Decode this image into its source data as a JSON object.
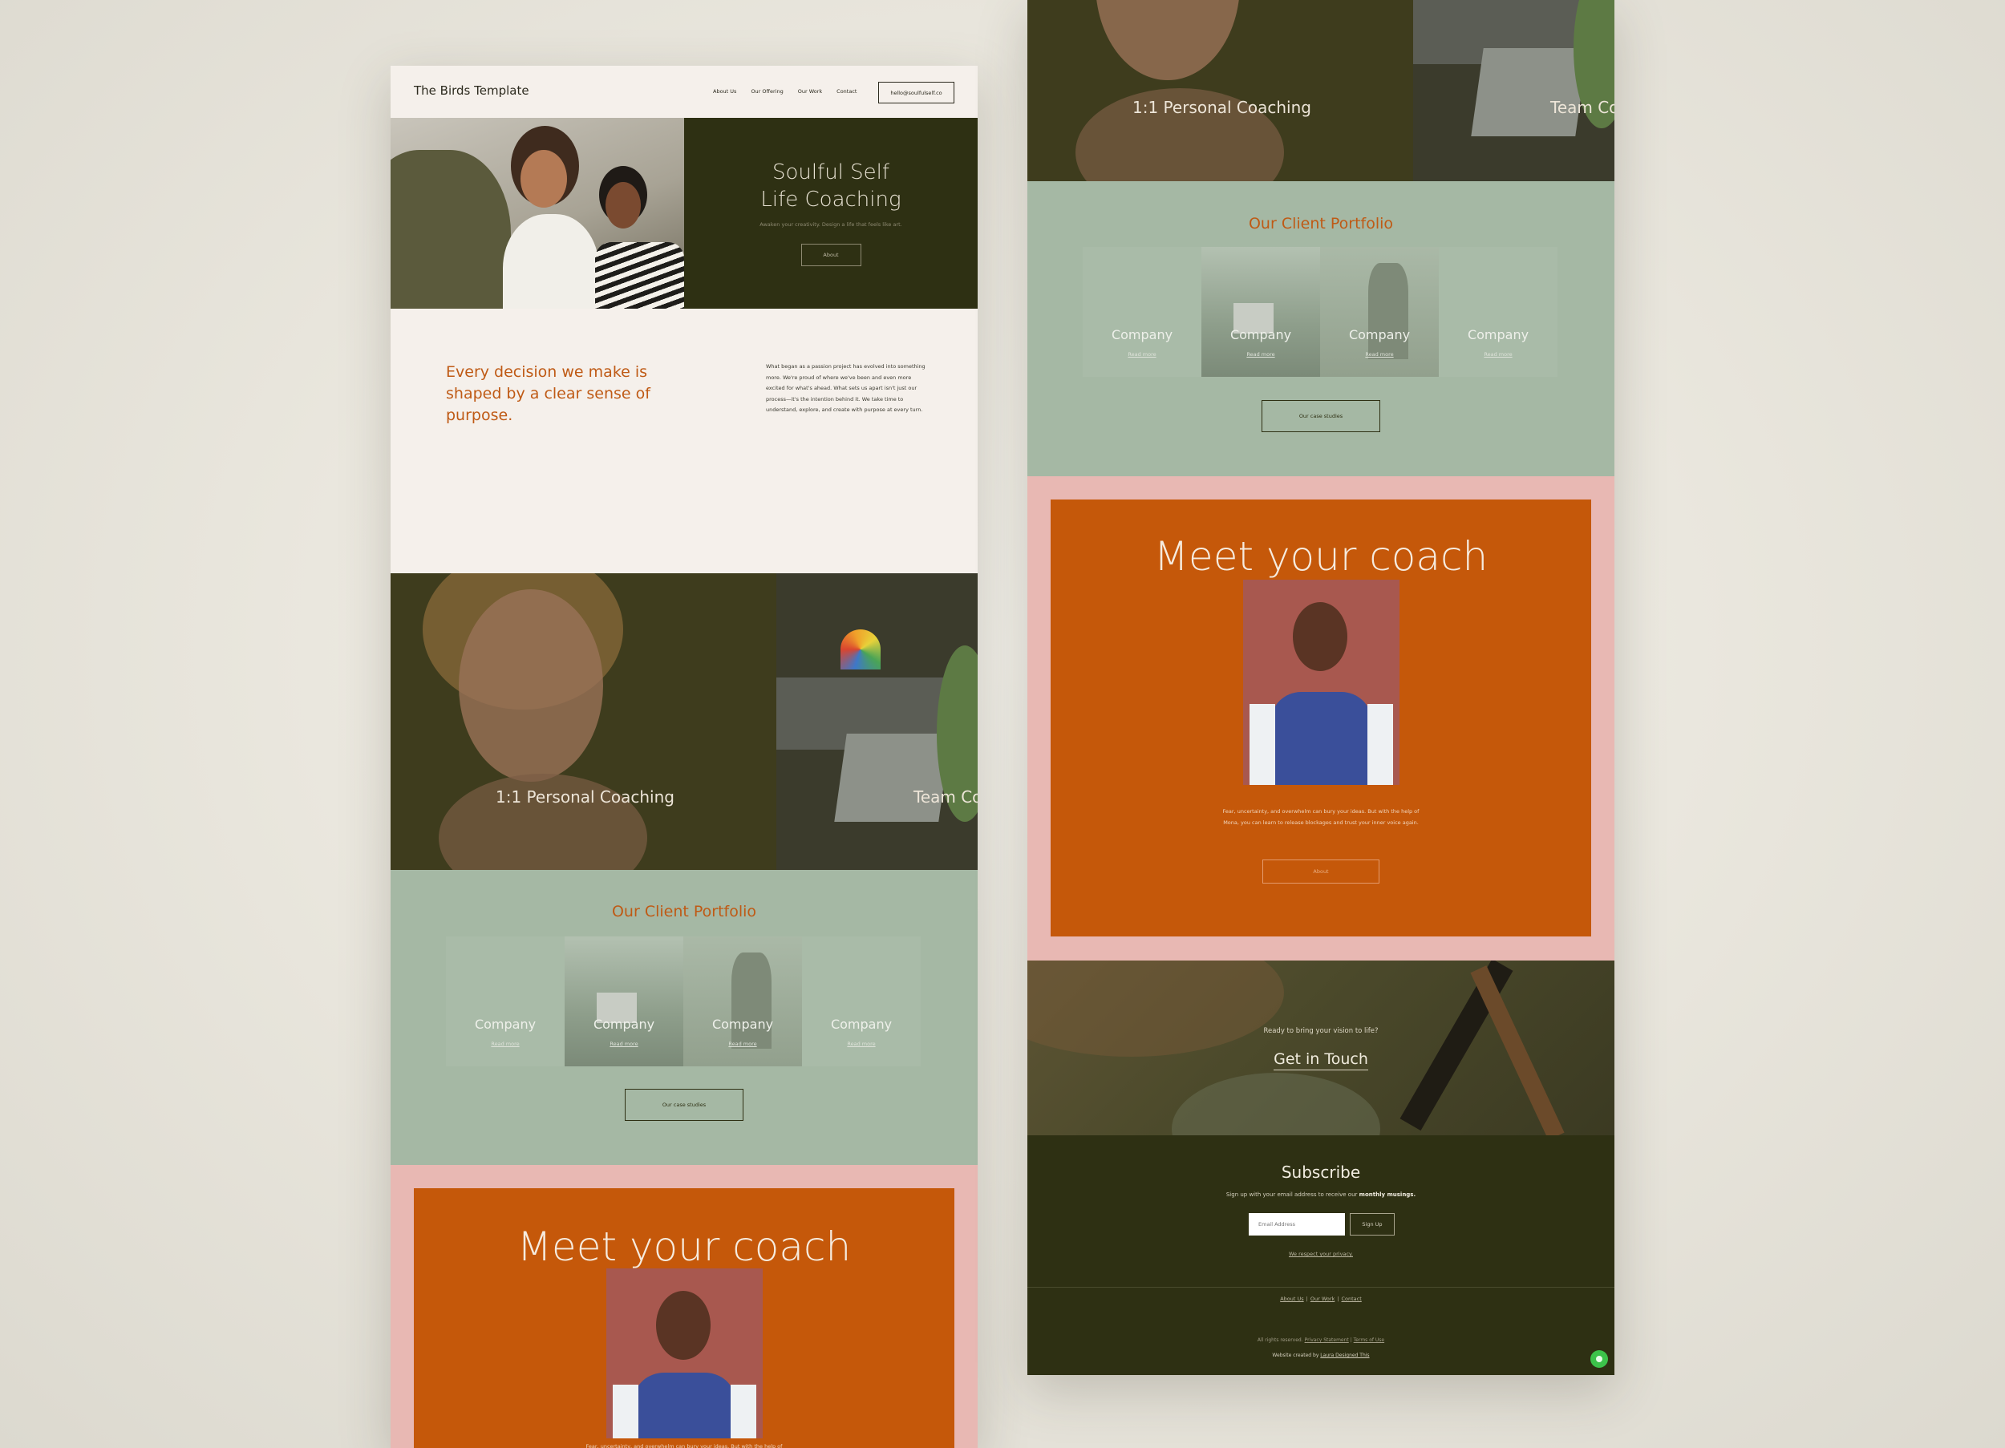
{
  "brand": "The Birds Template",
  "nav": {
    "links": [
      "About Us",
      "Our Offering",
      "Our Work",
      "Contact"
    ],
    "email": "hello@soulfulself.co"
  },
  "hero": {
    "title": "Soulful Self Life Coaching",
    "subtitle": "Awaken your creativity. Design a life that feels like art.",
    "button": "About"
  },
  "intro": {
    "heading": "Every decision we make is shaped by a clear sense of purpose.",
    "body": "What began as a passion project has evolved into something more. We're proud of where we've been and even more excited for what's ahead. What sets us apart isn't just our process—it's the intention behind it. We take time to understand, explore, and create with purpose at every turn."
  },
  "services": {
    "personal": "1:1 Personal Coaching",
    "team": "Team Coaching"
  },
  "portfolio": {
    "title": "Our Client Portfolio",
    "cards": [
      {
        "name": "Company",
        "link": "Read more"
      },
      {
        "name": "Company",
        "link": "Read more"
      },
      {
        "name": "Company",
        "link": "Read more"
      },
      {
        "name": "Company",
        "link": "Read more"
      }
    ],
    "button": "Our case studies"
  },
  "coach": {
    "title": "Meet your coach",
    "text": "Fear, uncertainty, and overwhelm can bury your ideas. But with the help of Mona, you can learn to release blockages and trust your inner voice again.",
    "button": "About"
  },
  "cta": {
    "pre": "Ready to bring your vision to life?",
    "main": "Get in Touch"
  },
  "subscribe": {
    "title": "Subscribe",
    "text": "Sign up with your email address to receive our",
    "text_bold": "monthly musings.",
    "placeholder": "Email Address",
    "button": "Sign Up",
    "privacy": "We respect your privacy."
  },
  "footer": {
    "links": [
      "About Us",
      "Our Work",
      "Contact"
    ],
    "rights": "All rights reserved.",
    "privacy": "Privacy Statement",
    "terms": "Terms of Use",
    "credit": "Website created by",
    "credit_link": "Laura Designed This"
  },
  "colors": {
    "olive": "#2e3013",
    "rust": "#c5580a",
    "sage": "#a5b8a4",
    "pink": "#e8b8b3",
    "cream": "#f5f0eb"
  }
}
